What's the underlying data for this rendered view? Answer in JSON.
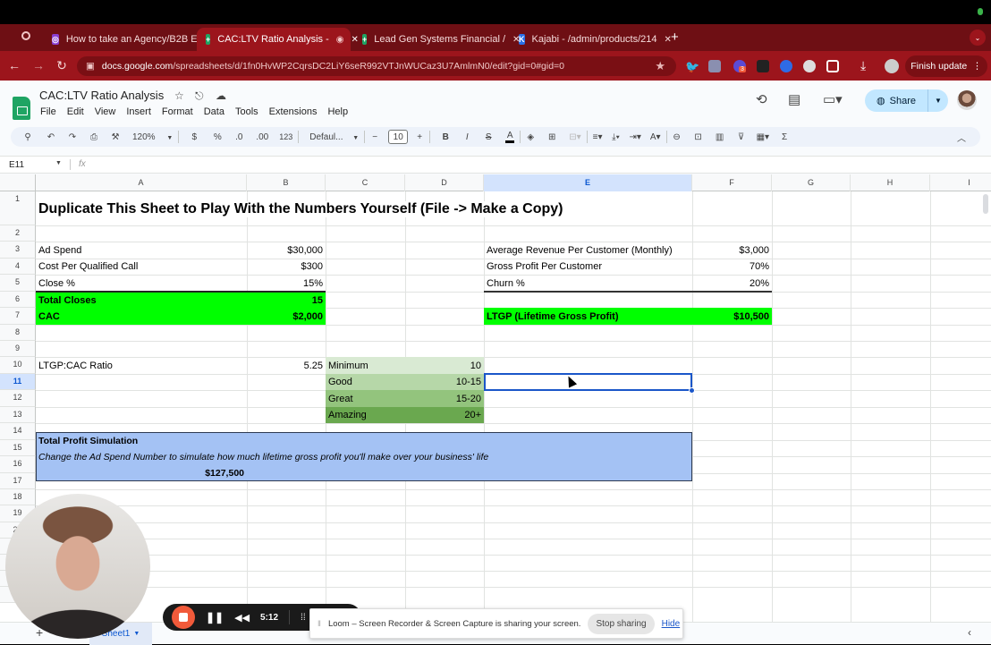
{
  "browser": {
    "tabs": [
      {
        "title": "How to take an Agency/B2B E",
        "icon": "loom-icon",
        "active": false
      },
      {
        "title": "CAC:LTV Ratio Analysis -",
        "icon": "sheets-icon",
        "active": true
      },
      {
        "title": "Lead Gen Systems Financial /",
        "icon": "sheets-icon",
        "active": false
      },
      {
        "title": "Kajabi - /admin/products/214",
        "icon": "kajabi-icon",
        "active": false
      }
    ],
    "url_domain": "docs.google.com",
    "url_path": "/spreadsheets/d/1fn0HvWP2CqrsDC2LiY6seR992VTJnWUCaz3U7AmlmN0/edit?gid=0#gid=0",
    "finish_update": "Finish update",
    "extension_badge": "3"
  },
  "app": {
    "title": "CAC:LTV Ratio Analysis",
    "menu": [
      "File",
      "Edit",
      "View",
      "Insert",
      "Format",
      "Data",
      "Tools",
      "Extensions",
      "Help"
    ],
    "share_label": "Share",
    "toolbar": {
      "zoom": "120%",
      "currency": "$",
      "percent": "%",
      "dec_decrease": ".0",
      "dec_increase": ".00",
      "more_formats": "123",
      "font": "Defaul...",
      "font_size": "10",
      "bold": "B",
      "italic": "I",
      "strike": "S",
      "text_color": "A",
      "sum": "Σ"
    },
    "name_box": "E11",
    "fx": "fx",
    "formula": ""
  },
  "grid": {
    "columns": [
      "A",
      "B",
      "C",
      "D",
      "E",
      "F",
      "G",
      "H",
      "I"
    ],
    "selected_column": "E",
    "rows": [
      "1",
      "2",
      "3",
      "4",
      "5",
      "6",
      "7",
      "8",
      "9",
      "10",
      "11",
      "12",
      "13",
      "14",
      "15",
      "16",
      "17",
      "18",
      "19",
      "20"
    ],
    "selected_row": "11",
    "title": "Duplicate This Sheet to Play With the Numbers Yourself (File -> Make a Copy)",
    "inputs_left": [
      {
        "label": "Ad Spend",
        "value": "$30,000"
      },
      {
        "label": "Cost Per Qualified Call",
        "value": "$300"
      },
      {
        "label": "Close %",
        "value": "15%"
      }
    ],
    "total_closes": {
      "label": "Total Closes",
      "value": "15"
    },
    "cac": {
      "label": "CAC",
      "value": "$2,000"
    },
    "inputs_right": [
      {
        "label": "Average Revenue Per Customer (Monthly)",
        "value": "$3,000"
      },
      {
        "label": "Gross Profit Per Customer",
        "value": "70%"
      },
      {
        "label": "Churn %",
        "value": "20%"
      }
    ],
    "ltgp": {
      "label": "LTGP (Lifetime Gross Profit)",
      "value": "$10,500"
    },
    "ratio": {
      "label": "LTGP:CAC Ratio",
      "value": "5.25"
    },
    "benchmarks": [
      {
        "label": "Minimum",
        "value": "10",
        "color": "#d9ead3"
      },
      {
        "label": "Good",
        "value": "10-15",
        "color": "#b6d7a8"
      },
      {
        "label": "Great",
        "value": "15-20",
        "color": "#93c47d"
      },
      {
        "label": "Amazing",
        "value": "20+",
        "color": "#6aa84f"
      }
    ],
    "simulation": {
      "title": "Total Profit Simulation",
      "note": "Change the Ad Spend Number to simulate how much lifetime gross profit you'll make over your business' life",
      "value": "$127,500",
      "color": "#a4c2f4"
    },
    "highlight_color": "#00ff00"
  },
  "sheet_tabs": {
    "add": "+",
    "active": "Sheet1"
  },
  "loom": {
    "timer": "5:12",
    "banner": "Loom – Screen Recorder & Screen Capture is sharing your screen.",
    "stop_sharing": "Stop sharing",
    "hide": "Hide"
  }
}
